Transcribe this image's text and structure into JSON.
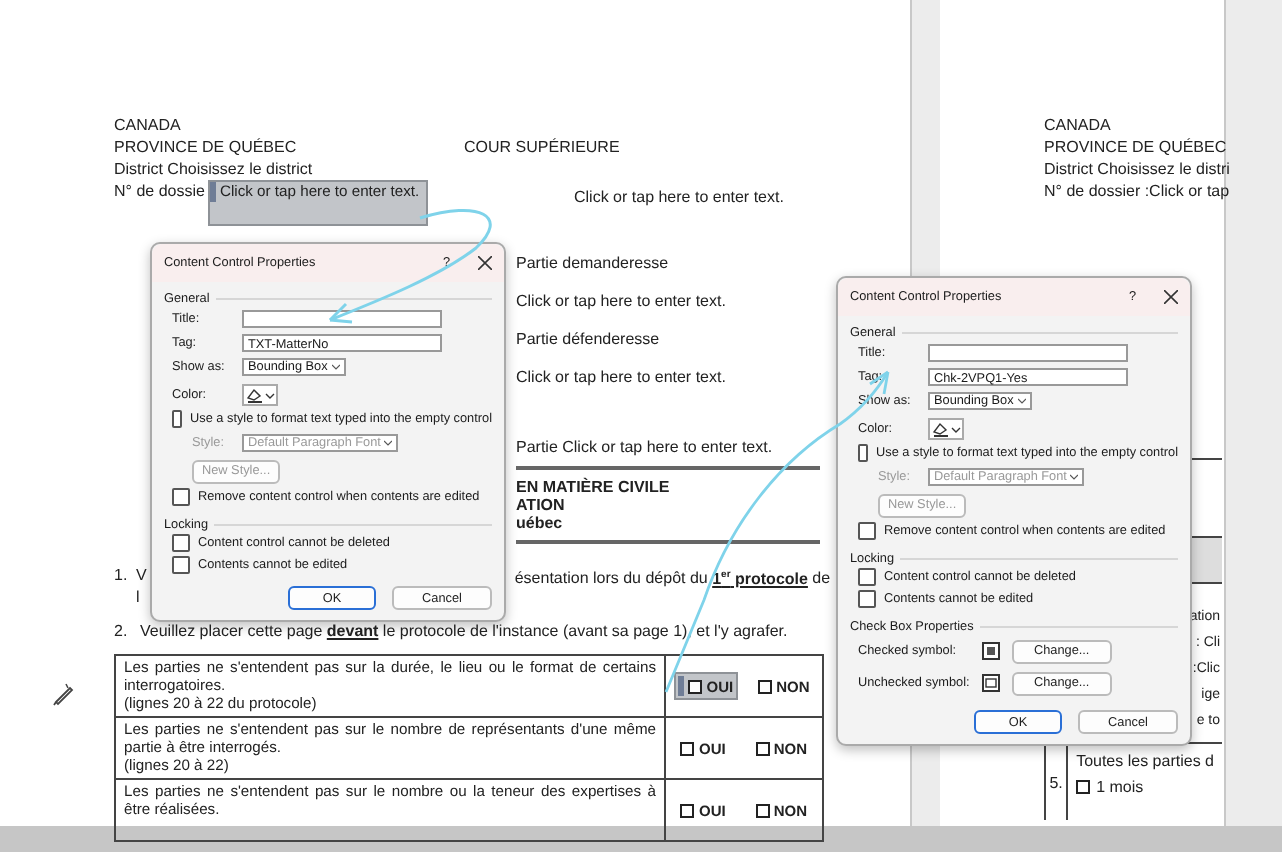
{
  "left_page": {
    "country": "CANADA",
    "province": "PROVINCE DE QUÉBEC",
    "court": "COUR SUPÉRIEURE",
    "district": "District Choisissez le district",
    "file_label": "N° de dossie",
    "file_field": {
      "placeholder": "Click or tap here to enter text.",
      "focused": true
    },
    "file_field_2": "Click or tap here to enter text.",
    "parties": [
      "Partie demanderesse",
      "Click or tap here to enter text.",
      "Partie défenderesse",
      "Click or tap here to enter text.",
      "Partie Click or tap here to enter text."
    ],
    "heading_lines": [
      "EN MATIÈRE CIVILE",
      "ATION",
      "uébec"
    ],
    "instruction_1": {
      "number": "1.",
      "start": "V",
      "end": "ésentation lors du dépôt du **1$^{er}$ protocole** de",
      "line_2": "l"
    },
    "instruction_2": {
      "number": "2.",
      "text": "Veuillez placer cette page **devant** le protocole de l'instance (avant sa page 1), et l'y agrafer."
    },
    "table": [
      {
        "text": "Les parties ne s'entendent pas sur la durée, le lieu ou le format de certains interrogatoires.",
        "ref": "(lignes 20 à 22 du protocole)",
        "options": [
          {
            "label": "OUI",
            "checked": false,
            "focused": true
          },
          {
            "label": "NON",
            "checked": false,
            "focused": false
          }
        ]
      },
      {
        "text": "Les parties ne s'entendent pas sur le nombre de représentants d'une même partie à être interrogés.",
        "ref": "(lignes 20 à 22)",
        "options": [
          {
            "label": "OUI",
            "checked": false,
            "focused": false
          },
          {
            "label": "NON",
            "checked": false,
            "focused": false
          }
        ]
      },
      {
        "text": "Les parties ne s'entendent pas sur le nombre ou la teneur des expertises à être réalisées.",
        "options": [
          {
            "label": "OUI",
            "checked": false,
            "focused": false
          },
          {
            "label": "NON",
            "checked": false,
            "focused": false
          }
        ]
      }
    ]
  },
  "right_page": {
    "lines": [
      "CANADA",
      "PROVINCE DE QUÉBEC",
      "District Choisissez le distri",
      "N° de dossier :Click or tap"
    ],
    "table_fragments": [
      "ation",
      ": Cli",
      ":Clic",
      "ige",
      "e to"
    ],
    "row_5": {
      "number": "5.",
      "text": "Toutes les parties d",
      "option": {
        "label": "1 mois",
        "checked": false
      }
    }
  },
  "dialogs": [
    {
      "kind": "text",
      "title": "Content Control Properties",
      "help": "?",
      "general": "General",
      "title_field": {
        "label": "Title:"
      },
      "tag_field": {
        "label": "Tag:",
        "value": "TXT-MatterNo"
      },
      "show_as": {
        "label": "Show as:",
        "value": "Bounding Box"
      },
      "color_label": "Color:",
      "style_checkbox": {
        "label": "Use a style to format text typed into the empty control",
        "checked": false
      },
      "style": {
        "label": "Style:",
        "value": "Default Paragraph Font",
        "disabled": true
      },
      "new_style": "New Style...",
      "remove_checkbox": {
        "label": "Remove content control when contents are edited",
        "checked": false
      },
      "locking": "Locking",
      "locks": [
        {
          "label": "Content control cannot be deleted",
          "checked": false
        },
        {
          "label": "Contents cannot be edited",
          "checked": false
        }
      ],
      "ok": "OK",
      "cancel": "Cancel"
    },
    {
      "kind": "checkbox",
      "title": "Content Control Properties",
      "help": "?",
      "general": "General",
      "title_field": {
        "label": "Title:"
      },
      "tag_field": {
        "label": "Tag:",
        "value": "Chk-2VPQ1-Yes"
      },
      "show_as": {
        "label": "Show as:",
        "value": "Bounding Box"
      },
      "color_label": "Color:",
      "style_checkbox": {
        "label": "Use a style to format text typed into the empty control",
        "checked": false
      },
      "style": {
        "label": "Style:",
        "value": "Default Paragraph Font",
        "disabled": true
      },
      "new_style": "New Style...",
      "remove_checkbox": {
        "label": "Remove content control when contents are edited",
        "checked": false
      },
      "locking": "Locking",
      "locks": [
        {
          "label": "Content control cannot be deleted",
          "checked": false
        },
        {
          "label": "Contents cannot be edited",
          "checked": false
        }
      ],
      "checkbox_properties": {
        "title": "Check Box Properties",
        "checked_label": "Checked symbol:",
        "unchecked_label": "Unchecked symbol:",
        "change_1": "Change...",
        "change_2": "Change..."
      },
      "ok": "OK",
      "cancel": "Cancel"
    }
  ]
}
